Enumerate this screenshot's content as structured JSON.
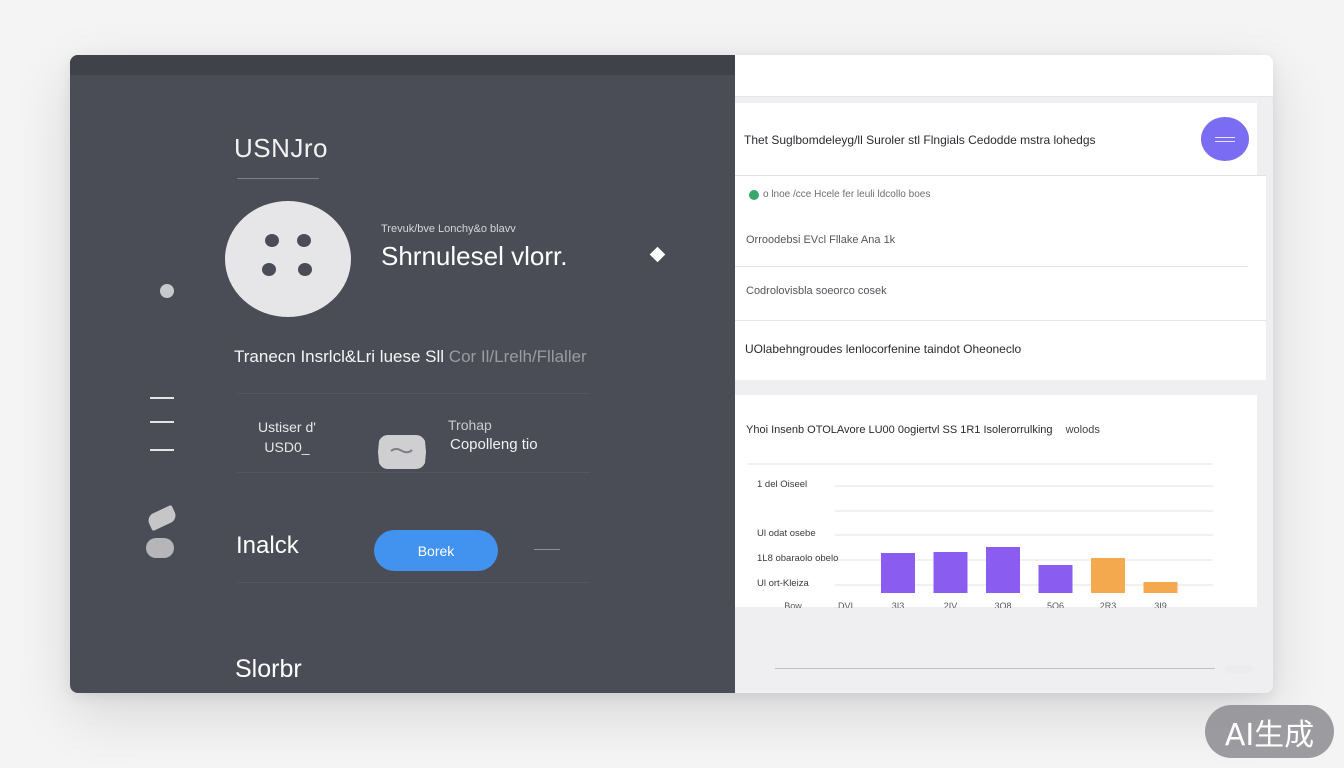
{
  "left_panel": {
    "brand": "USNJro",
    "profile": {
      "kicker": "Trevuk/bve Lonchy&o blavv",
      "name": "Shrnulesel vlorr."
    },
    "section_line": {
      "main": "Tranecn Insrlcl&Lri luese Sll",
      "dim": "Cor Il/Lrelh/Fllaller"
    },
    "user": {
      "line1": "Ustiser d'",
      "line2": "USD0_"
    },
    "badge": {
      "kicker": "Trohap",
      "text": "Copolleng tio"
    },
    "action": {
      "label": "Inalck",
      "button": "Borek"
    },
    "footer": "Slorbr"
  },
  "right_panel": {
    "search_text": "Thet Suglbomdeleyg/ll Suroler stl Flngials Cedodde mstra lohedgs",
    "list": {
      "kicker": "o lnoe /cce Hcele fer leuli ldcollo boes",
      "items": [
        "Orroodebsi EVcl Fllake Ana 1k",
        "Codrolovisbla soeorco cosek",
        "UOlabehngroudes lenlocorfenine taindot Oheoneclo"
      ]
    },
    "chart_title": "Yhoi Insenb OTOLAvore LU00 0ogiertvl SS 1R1 Isolerorrulking",
    "chart_title_tail": "wolods"
  },
  "chart_data": {
    "type": "bar",
    "categories": [
      "Bow",
      "DVI",
      "3I3",
      "2IV",
      "3O8",
      "5O6",
      "2R3",
      "3I9"
    ],
    "values": [
      0,
      0,
      2,
      2.05,
      2.3,
      1.4,
      1.75,
      0.55
    ],
    "bar_colors": [
      "#8b5cf0",
      "#8b5cf0",
      "#8b5cf0",
      "#8b5cf0",
      "#8b5cf0",
      "#8b5cf0",
      "#f5a94e",
      "#f5a94e"
    ],
    "y_tick_labels": [
      "Ul ort-Kleiza",
      "1L8 obaraolo obelo",
      "Ul odat osebe",
      "",
      "1 del Oiseel"
    ],
    "ylim": [
      0,
      6
    ]
  },
  "watermark": "AI生成"
}
